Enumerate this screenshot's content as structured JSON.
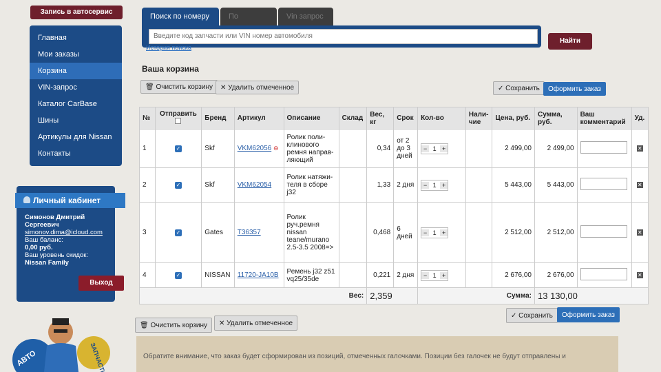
{
  "sidebar": {
    "signup_button": "Запись в автосервис",
    "nav_items": [
      {
        "label": "Главная"
      },
      {
        "label": "Мои заказы"
      },
      {
        "label": "Корзина"
      },
      {
        "label": "VIN-запрос"
      },
      {
        "label": "Каталог CarBase"
      },
      {
        "label": "Шины"
      },
      {
        "label": "Артикулы для Nissan"
      },
      {
        "label": "Контакты"
      }
    ],
    "active_item": "Корзина"
  },
  "cabinet": {
    "title": "Личный кабинет",
    "name": "Симонов Дмитрий Сергеевич",
    "email": "simonov.dima@icloud.com",
    "balance_label": "Ваш баланс:",
    "balance_value": "0,00 руб.",
    "discount_label": "Ваш уровень скидок:",
    "discount_value": "Nissan Family",
    "exit_button": "Выход"
  },
  "search": {
    "tabs": [
      {
        "label": "Поиск по номеру"
      },
      {
        "label": "По каталогам"
      },
      {
        "label": "Vin запрос"
      }
    ],
    "placeholder": "Введите код запчасти или VIN номер автомобиля",
    "history_link": "История поиска",
    "search_button": "Найти"
  },
  "cart": {
    "title": "Ваша корзина",
    "clear_button": "Очистить корзину",
    "delete_selected_button": "Удалить отмеченное",
    "save_button": "Сохранить",
    "order_button": "Оформить заказ",
    "columns": {
      "num": "№",
      "send": "Отправить",
      "brand": "Бренд",
      "sku": "Артикул",
      "description": "Описание",
      "warehouse": "Склад",
      "weight": "Вес, кг",
      "term": "Срок",
      "qty": "Кол-во",
      "stock": "Нали-чие",
      "price": "Цена, руб.",
      "sum": "Сумма, руб.",
      "comment": "Ваш комментарий",
      "delete": "Уд."
    },
    "rows": [
      {
        "num": "1",
        "brand": "Skf",
        "sku": "VKM62056",
        "description": "Ролик поли-клинового ремня направ-ляющий",
        "weight": "0,34",
        "term": "от 2 до 3 дней",
        "qty": "1",
        "price": "2 499,00",
        "sum": "2 499,00"
      },
      {
        "num": "2",
        "brand": "Skf",
        "sku": "VKM62054",
        "description": "Ролик натяжи-теля в сборе j32",
        "weight": "1,33",
        "term": "2 дня",
        "qty": "1",
        "price": "5 443,00",
        "sum": "5 443,00"
      },
      {
        "num": "3",
        "brand": "Gates",
        "sku": "T36357",
        "description": "Ролик руч.ремня nissan teane/murano 2.5-3.5 2008=>",
        "weight": "0,468",
        "term": "6 дней",
        "qty": "1",
        "price": "2 512,00",
        "sum": "2 512,00"
      },
      {
        "num": "4",
        "brand": "NISSAN",
        "sku": "11720-JA10B",
        "description": "Ремень j32 z51 vq25/35de",
        "weight": "0,221",
        "term": "2 дня",
        "qty": "1",
        "price": "2 676,00",
        "sum": "2 676,00"
      }
    ],
    "weight_label": "Вес:",
    "weight_total": "2,359",
    "sum_label": "Сумма:",
    "sum_total": "13 130,00",
    "notice": "Обратите внимание, что заказ будет сформирован из позиций, отмеченных галочками. Позиции без галочек не будут отправлены и"
  },
  "colors": {
    "nav_blue": "#1c4b86",
    "active_blue": "#2e6db8",
    "brand_maroon": "#6e1f2c",
    "link_blue": "#2a5fa8"
  }
}
